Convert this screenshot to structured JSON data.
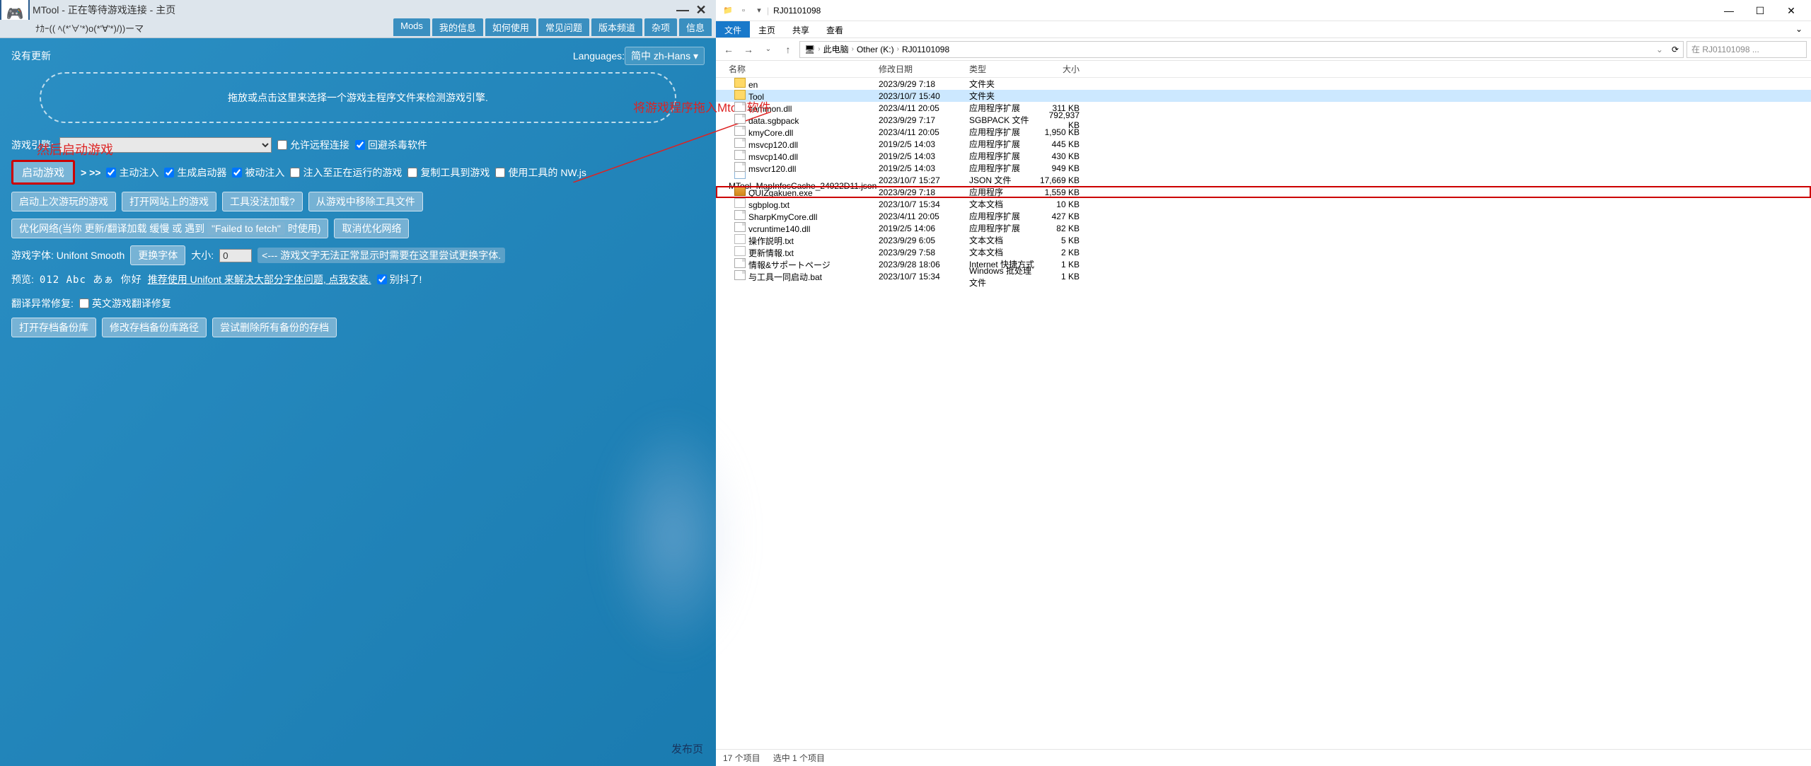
{
  "mtool": {
    "title": "MTool - 正在等待游戏连接 - 主页",
    "subtitle": "ﾅｶｰ(( ﾍ(*'∀'*)o(*'∀'*)/))ーマ",
    "tabs": [
      "Mods",
      "我的信息",
      "如何使用",
      "常见问题",
      "版本频道",
      "杂项",
      "信息"
    ],
    "no_update": "没有更新",
    "lang_label": "Languages:",
    "lang_value": "简中 zh-Hans",
    "dropzone": "拖放或点击这里来选择一个游戏主程序文件来检测游戏引擎.",
    "engine_label": "游戏引擎:",
    "allow_remote": "允许远程连接",
    "avoid_av": "回避杀毒软件",
    "start_game": "启动游戏",
    "arrows": "> >>",
    "inject_active": "主动注入",
    "gen_launcher": "生成启动器",
    "inject_passive": "被动注入",
    "inject_running": "注入至正在运行的游戏",
    "copy_tool": "复制工具到游戏",
    "use_nwjs": "使用工具的 NW.js",
    "btn_start_last": "启动上次游玩的游戏",
    "btn_open_web": "打开网站上的游戏",
    "btn_tool_fail": "工具没法加载?",
    "btn_remove_tool": "从游戏中移除工具文件",
    "opt_net_prefix": "优化网络(当你 更新/翻译加载 缓慢 或 遇到",
    "opt_net_code": "\"Failed to fetch\"",
    "opt_net_suffix": "时使用)",
    "btn_cancel_opt": "取消优化网络",
    "font_label": "游戏字体: Unifont Smooth",
    "btn_change_font": "更换字体",
    "size_label": "大小:",
    "size_value": "0",
    "font_hint": "<--- 游戏文字无法正常显示时需要在这里尝试更换字体.",
    "preview_label": "预览:",
    "preview_text": "012 Abc あぁ 你好",
    "unifont_link": "推荐使用 Unifont 来解决大部分字体问题, 点我安装.",
    "no_shake": "别抖了!",
    "trans_fix_label": "翻译异常修复:",
    "trans_fix_chk": "英文游戏翻译修复",
    "btn_open_save": "打开存档备份库",
    "btn_mod_save": "修改存档备份库路径",
    "btn_del_save": "尝试删除所有备份的存档",
    "publish": "发布页"
  },
  "annotations": {
    "anno1": "然后启动游戏",
    "anno2": "将游戏程序拖入Mtool软件"
  },
  "explorer": {
    "title": "RJ01101098",
    "menu": {
      "file": "文件",
      "home": "主页",
      "share": "共享",
      "view": "查看"
    },
    "breadcrumb": {
      "pc": "此电脑",
      "drive": "Other (K:)",
      "folder": "RJ01101098"
    },
    "search_placeholder": "在 RJ01101098 ...",
    "columns": {
      "name": "名称",
      "date": "修改日期",
      "type": "类型",
      "size": "大小"
    },
    "files": [
      {
        "name": "en",
        "date": "2023/9/29 7:18",
        "type": "文件夹",
        "size": "",
        "ico": "folder"
      },
      {
        "name": "Tool",
        "date": "2023/10/7 15:40",
        "type": "文件夹",
        "size": "",
        "ico": "folder",
        "selected": true
      },
      {
        "name": "common.dll",
        "date": "2023/4/11 20:05",
        "type": "应用程序扩展",
        "size": "311 KB",
        "ico": "file"
      },
      {
        "name": "data.sgbpack",
        "date": "2023/9/29 7:17",
        "type": "SGBPACK 文件",
        "size": "792,937 KB",
        "ico": "file"
      },
      {
        "name": "kmyCore.dll",
        "date": "2023/4/11 20:05",
        "type": "应用程序扩展",
        "size": "1,950 KB",
        "ico": "file"
      },
      {
        "name": "msvcp120.dll",
        "date": "2019/2/5 14:03",
        "type": "应用程序扩展",
        "size": "445 KB",
        "ico": "file"
      },
      {
        "name": "msvcp140.dll",
        "date": "2019/2/5 14:03",
        "type": "应用程序扩展",
        "size": "430 KB",
        "ico": "file"
      },
      {
        "name": "msvcr120.dll",
        "date": "2019/2/5 14:03",
        "type": "应用程序扩展",
        "size": "949 KB",
        "ico": "file"
      },
      {
        "name": "MTool_MapInfosCache_24922D11.json",
        "date": "2023/10/7 15:27",
        "type": "JSON 文件",
        "size": "17,669 KB",
        "ico": "json"
      },
      {
        "name": "QUIZgakuen.exe",
        "date": "2023/9/29 7:18",
        "type": "应用程序",
        "size": "1,559 KB",
        "ico": "exe",
        "highlighted": true
      },
      {
        "name": "sgbplog.txt",
        "date": "2023/10/7 15:34",
        "type": "文本文档",
        "size": "10 KB",
        "ico": "txt"
      },
      {
        "name": "SharpKmyCore.dll",
        "date": "2023/4/11 20:05",
        "type": "应用程序扩展",
        "size": "427 KB",
        "ico": "file"
      },
      {
        "name": "vcruntime140.dll",
        "date": "2019/2/5 14:06",
        "type": "应用程序扩展",
        "size": "82 KB",
        "ico": "file"
      },
      {
        "name": "操作説明.txt",
        "date": "2023/9/29 6:05",
        "type": "文本文档",
        "size": "5 KB",
        "ico": "txt"
      },
      {
        "name": "更新情報.txt",
        "date": "2023/9/29 7:58",
        "type": "文本文档",
        "size": "2 KB",
        "ico": "txt"
      },
      {
        "name": "情報&サポートページ",
        "date": "2023/9/28 18:06",
        "type": "Internet 快捷方式",
        "size": "1 KB",
        "ico": "file"
      },
      {
        "name": "与工具一同启动.bat",
        "date": "2023/10/7 15:34",
        "type": "Windows 批处理文件",
        "size": "1 KB",
        "ico": "file"
      }
    ],
    "status": {
      "count": "17 个项目",
      "selected": "选中 1 个项目"
    }
  }
}
